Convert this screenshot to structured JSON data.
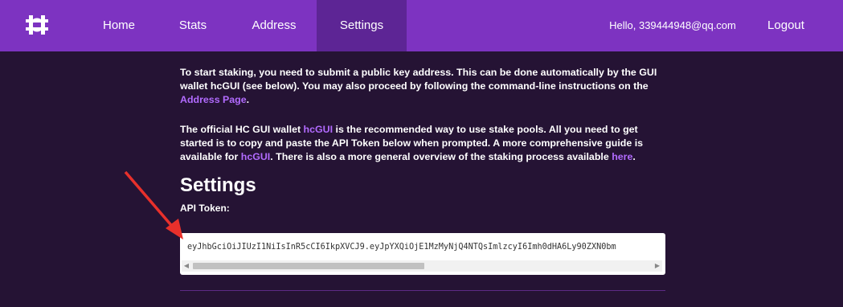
{
  "nav": {
    "home": "Home",
    "stats": "Stats",
    "address": "Address",
    "settings": "Settings",
    "greeting": "Hello, 339444948@qq.com",
    "logout": "Logout"
  },
  "intro": {
    "p1_text": "To start staking, you need to submit a public key address. This can be done automatically by the GUI wallet hcGUI (see below). You may also proceed by following the command-line instructions on the",
    "p1_link": "Address Page",
    "p1_end": ".",
    "p2_a": "The official HC GUI wallet",
    "p2_link1": "hcGUI",
    "p2_b": "is the recommended way to use stake pools. All you need to get started is to copy and paste the API Token below when prompted. A more comprehensive guide is available for",
    "p2_link2": "hcGUI",
    "p2_c": ". There is also a more general overview of the staking process available",
    "p2_link3": "here",
    "p2_end": "."
  },
  "settings": {
    "heading": "Settings",
    "token_label": "API Token:",
    "token_value": "eyJhbGciOiJIUzI1NiIsInR5cCI6IkpXVCJ9.eyJpYXQiOjE1MzMyNjQ4NTQsImlzcyI6Imh0dHA6Ly90ZXN0bm"
  },
  "colors": {
    "accent": "#7d33c1",
    "active_tab": "#5d2595",
    "background": "#251334",
    "link": "#b26bff"
  }
}
